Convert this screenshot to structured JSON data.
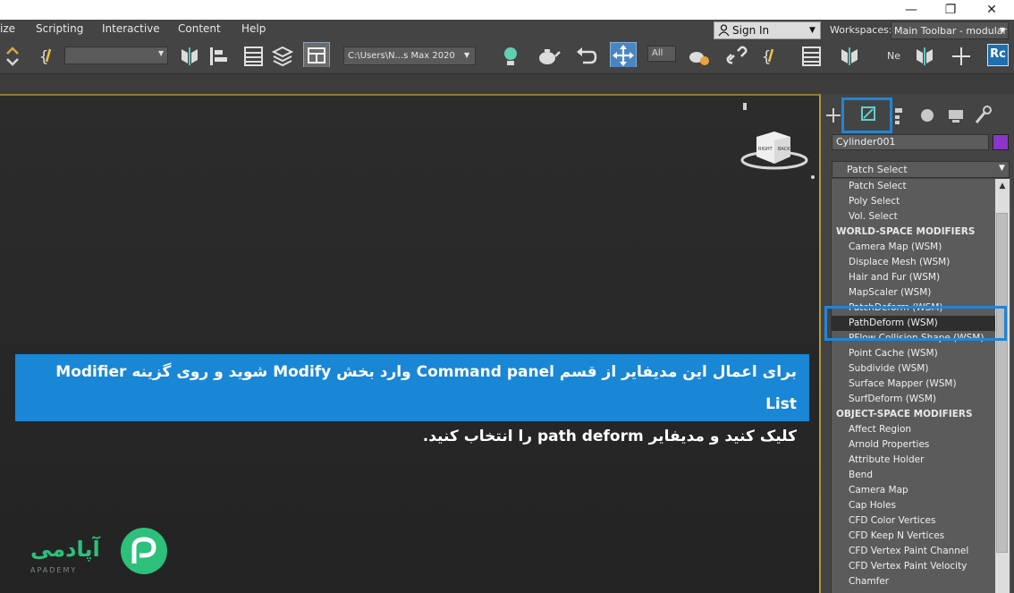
{
  "window": {
    "minimize": "—",
    "maximize": "❐",
    "close": "✕"
  },
  "menu": {
    "items": [
      "ize",
      "Scripting",
      "Interactive",
      "Content",
      "Help"
    ]
  },
  "signin": {
    "label": "Sign In"
  },
  "workspaces": {
    "label": "Workspaces:",
    "value": "Main Toolbar - modular"
  },
  "toolbar": {
    "project_path": "C:\\Users\\N...s Max 2020",
    "filter": "All",
    "rc_label": "Rc",
    "ne_label": "Ne"
  },
  "viewcube": {
    "left_face": "RIGHT",
    "right_face": "BACK"
  },
  "command_panel": {
    "object_name": "Cylinder001",
    "object_color": "#8a36c8",
    "modifier_list_value": "Patch Select",
    "list": [
      {
        "label": "Patch Select",
        "type": "item"
      },
      {
        "label": "Poly Select",
        "type": "item"
      },
      {
        "label": "Vol. Select",
        "type": "item"
      },
      {
        "label": "WORLD-SPACE MODIFIERS",
        "type": "head"
      },
      {
        "label": "Camera Map (WSM)",
        "type": "item"
      },
      {
        "label": "Displace Mesh (WSM)",
        "type": "item"
      },
      {
        "label": "Hair and Fur (WSM)",
        "type": "item"
      },
      {
        "label": "MapScaler (WSM)",
        "type": "item"
      },
      {
        "label": "PatchDeform (WSM)",
        "type": "item"
      },
      {
        "label": "PathDeform (WSM)",
        "type": "item",
        "selected": true
      },
      {
        "label": "PFlow Collision Shape (WSM)",
        "type": "item"
      },
      {
        "label": "Point Cache (WSM)",
        "type": "item"
      },
      {
        "label": "Subdivide (WSM)",
        "type": "item"
      },
      {
        "label": "Surface Mapper (WSM)",
        "type": "item"
      },
      {
        "label": "SurfDeform (WSM)",
        "type": "item"
      },
      {
        "label": "OBJECT-SPACE MODIFIERS",
        "type": "head"
      },
      {
        "label": "Affect Region",
        "type": "item"
      },
      {
        "label": "Arnold Properties",
        "type": "item"
      },
      {
        "label": "Attribute Holder",
        "type": "item"
      },
      {
        "label": "Bend",
        "type": "item"
      },
      {
        "label": "Camera Map",
        "type": "item"
      },
      {
        "label": "Cap Holes",
        "type": "item"
      },
      {
        "label": "CFD Color Vertices",
        "type": "item"
      },
      {
        "label": "CFD Keep N Vertices",
        "type": "item"
      },
      {
        "label": "CFD Vertex Paint Channel",
        "type": "item"
      },
      {
        "label": "CFD Vertex Paint Velocity",
        "type": "item"
      },
      {
        "label": "Chamfer",
        "type": "item"
      }
    ]
  },
  "caption": {
    "line1": "برای اعمال این مدیفایر از قسم Command panel وارد بخش Modify شوید و روی گزینه Modifier List",
    "line2": "کلیک کنید و مدیفایر path deform را انتخاب کنید."
  },
  "logo": {
    "brand": "آپادمی",
    "sub": "APADEMY"
  },
  "colors": {
    "highlight": "#1e86d8",
    "caption_bg": "#1a86d6",
    "logo_green": "#2cc07a"
  }
}
